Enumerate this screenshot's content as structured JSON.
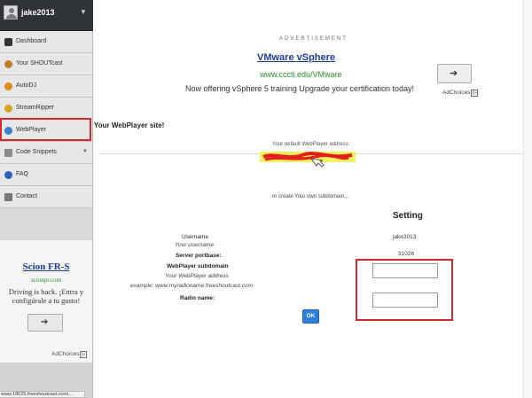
{
  "user": {
    "name": "jake2013",
    "caret": "▼"
  },
  "sidebar": {
    "items": [
      {
        "label": "Dashboard",
        "icon": "dashboard-icon",
        "color": "#333333"
      },
      {
        "label": "Your SHOUTcast",
        "icon": "radio-icon",
        "color": "#c87a2b"
      },
      {
        "label": "AutoDJ",
        "icon": "autodj-icon",
        "color": "#e08a1c"
      },
      {
        "label": "StreamRipper",
        "icon": "streamripper-icon",
        "color": "#d9a321"
      },
      {
        "label": "WebPlayer",
        "icon": "globe-icon",
        "color": "#3b7fd4"
      },
      {
        "label": "Code Snippets",
        "icon": "code-icon",
        "color": "#8a8a8a",
        "arrow": "▼"
      },
      {
        "label": "FAQ",
        "icon": "info-icon",
        "color": "#2f5fb8"
      },
      {
        "label": "Contact",
        "icon": "contact-icon",
        "color": "#777777"
      }
    ]
  },
  "side_ad": {
    "title": "Scion FR-S",
    "url": "scionpr.com",
    "text": "Driving is back. ¡Entra y configúrale a tu gusto!",
    "button": "➔",
    "adchoices": "AdChoices"
  },
  "statusbar": "www.18025.freeshoutcast.com/...",
  "main_ad": {
    "label": "ADVERTISEMENT",
    "title": "VMware vSphere",
    "url": "www.cccti.edu/VMware",
    "text": "Now offering vSphere 5 training Upgrade your certification today!",
    "button": "➔",
    "adchoices": "AdChoices"
  },
  "page": {
    "heading": "Your WebPlayer site!",
    "default_address_label": "Your default WebPlayer address:",
    "subdomain_text": "or create Your own subdomain...",
    "setting_title": "Setting"
  },
  "form": {
    "username_label": "Username",
    "username_hint": "Your username",
    "username_value": "jake2013",
    "port_label": "Server portbase:",
    "port_value": "31026",
    "subdomain_label": "WebPlayer subdomain",
    "subdomain_hint": "Your WebPlayer address",
    "subdomain_example": "example: www.myradioname.freeshoutcast.com",
    "subdomain_value": "",
    "radio_label": "Radio name:",
    "radio_value": "",
    "ok_label": "OK"
  },
  "colors": {
    "highlight_red": "#d8262b",
    "ok_blue": "#2d7fd8",
    "ad_link": "#1a3d9b",
    "ad_url": "#2c8e2c"
  }
}
